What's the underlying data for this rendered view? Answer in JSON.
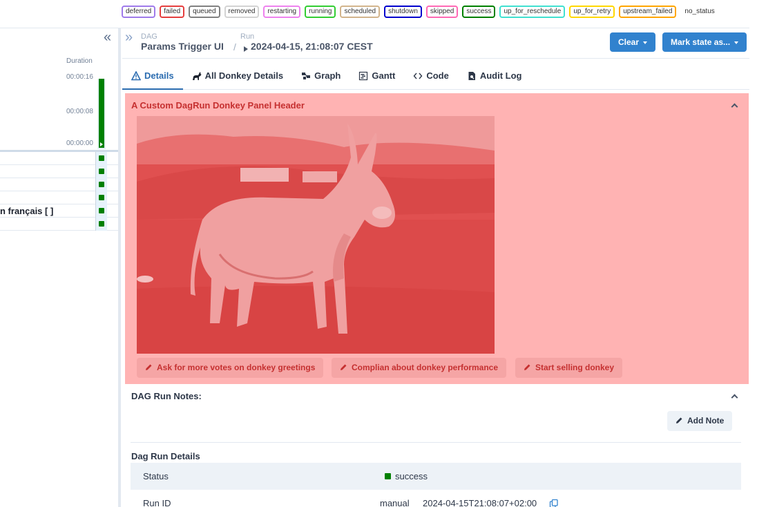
{
  "legend": [
    {
      "label": "deferred",
      "color": "#9f7aea"
    },
    {
      "label": "failed",
      "color": "#e53e3e"
    },
    {
      "label": "queued",
      "color": "#808080"
    },
    {
      "label": "removed",
      "color": "#d3d3d3"
    },
    {
      "label": "restarting",
      "color": "#ee82ee"
    },
    {
      "label": "running",
      "color": "#32cd32"
    },
    {
      "label": "scheduled",
      "color": "#d2b48c"
    },
    {
      "label": "shutdown",
      "color": "#0000cd"
    },
    {
      "label": "skipped",
      "color": "#ff69b4"
    },
    {
      "label": "success",
      "color": "#008000"
    },
    {
      "label": "up_for_reschedule",
      "color": "#40e0d0"
    },
    {
      "label": "up_for_retry",
      "color": "#ffd700"
    },
    {
      "label": "upstream_failed",
      "color": "#ffa500"
    },
    {
      "label": "no_status",
      "color": ""
    }
  ],
  "grid": {
    "duration_label": "Duration",
    "ticks": [
      "00:00:16",
      "00:00:08",
      "00:00:00"
    ],
    "run_state_color": "#008000",
    "rows": [
      "",
      "",
      "",
      "",
      "n français [ ]",
      ""
    ]
  },
  "breadcrumb": {
    "dag_label": "DAG",
    "dag_value": "Params Trigger UI",
    "separator": "/",
    "run_label": "Run",
    "run_value": "2024-04-15, 21:08:07 CEST"
  },
  "actions": {
    "clear_label": "Clear",
    "mark_state_label": "Mark state as..."
  },
  "tabs": [
    {
      "label": "Details",
      "icon": "warning-triangle-icon",
      "active": true
    },
    {
      "label": "All Donkey Details",
      "icon": "donkey-icon",
      "active": false
    },
    {
      "label": "Graph",
      "icon": "graph-icon",
      "active": false
    },
    {
      "label": "Gantt",
      "icon": "gantt-icon",
      "active": false
    },
    {
      "label": "Code",
      "icon": "code-icon",
      "active": false
    },
    {
      "label": "Audit Log",
      "icon": "audit-log-icon",
      "active": false
    }
  ],
  "donkey_panel": {
    "header": "A Custom DagRun Donkey Panel Header",
    "image_subject": "donkey-photo",
    "buttons": [
      "Ask for more votes on donkey greetings",
      "Complian about donkey performance",
      "Start selling donkey"
    ]
  },
  "notes": {
    "title": "DAG Run Notes:",
    "add_note_label": "Add Note"
  },
  "dag_run_details": {
    "title": "Dag Run Details",
    "rows": [
      {
        "key": "Status",
        "value": "success",
        "status_color": "#008000"
      },
      {
        "key": "Run ID",
        "value_prefix": "manual",
        "value": "2024-04-15T21:08:07+02:00"
      }
    ]
  }
}
